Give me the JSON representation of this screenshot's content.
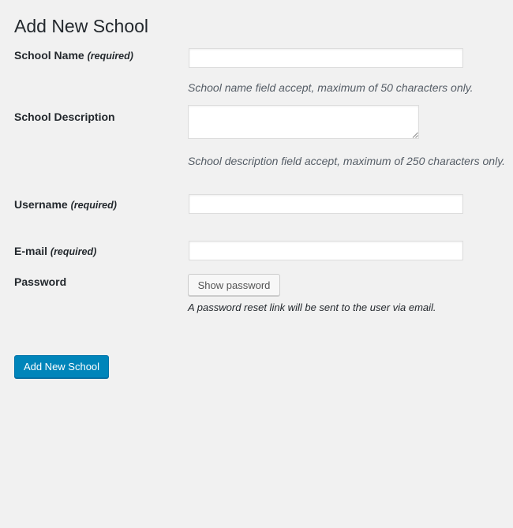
{
  "page": {
    "title": "Add New School"
  },
  "form": {
    "school_name": {
      "label": "School Name",
      "required_marker": "(required)",
      "value": "",
      "hint": "School name field accept, maximum of 50 characters only."
    },
    "school_description": {
      "label": "School Description",
      "value": "",
      "hint": "School description field accept, maximum of 250 characters only."
    },
    "username": {
      "label": "Username",
      "required_marker": "(required)",
      "value": ""
    },
    "email": {
      "label": "E-mail",
      "required_marker": "(required)",
      "value": ""
    },
    "password": {
      "label": "Password",
      "show_button_label": "Show password",
      "hint": "A password reset link will be sent to the user via email."
    },
    "submit_label": "Add New School"
  },
  "colors": {
    "background": "#f1f1f1",
    "primary_button": "#0085ba",
    "primary_button_border": "#0073aa",
    "input_border": "#dddddd",
    "hint_text": "#555d66"
  }
}
